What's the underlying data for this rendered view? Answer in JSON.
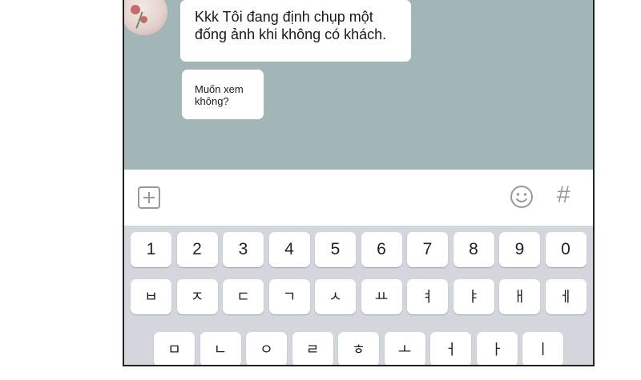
{
  "chat": {
    "messages": [
      {
        "text": "Kkk Tôi đang định chụp một đống ảnh khi không có khách."
      },
      {
        "text": "Muốn xem không?"
      }
    ]
  },
  "input_bar": {
    "icons": [
      "plus-square-icon",
      "smiley-icon",
      "hash-icon"
    ],
    "hash_symbol": "#"
  },
  "keyboard": {
    "number_row": [
      "1",
      "2",
      "3",
      "4",
      "5",
      "6",
      "7",
      "8",
      "9",
      "0"
    ],
    "row2": [
      "ㅂ",
      "ㅈ",
      "ㄷ",
      "ㄱ",
      "ㅅ",
      "ㅛ",
      "ㅕ",
      "ㅑ",
      "ㅐ",
      "ㅔ"
    ],
    "row3": [
      "ㅁ",
      "ㄴ",
      "ㅇ",
      "ㄹ",
      "ㅎ",
      "ㅗ",
      "ㅓ",
      "ㅏ",
      "ㅣ"
    ]
  },
  "colors": {
    "chat_background": "#a3b6b7",
    "keyboard_background": "#d3d6dd",
    "icon_gray": "#9a9a9a"
  }
}
